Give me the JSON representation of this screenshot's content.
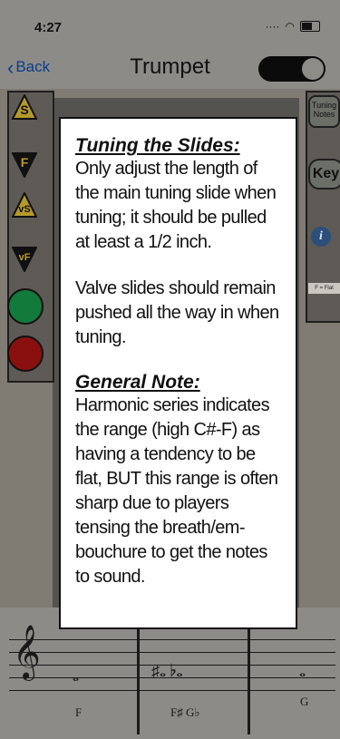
{
  "status": {
    "time": "4:27"
  },
  "nav": {
    "back_label": "Back",
    "title": "Trumpet"
  },
  "left_panel": {
    "up_label": "S",
    "down_label": "F",
    "vs_label": "vS",
    "vf_label": "vF"
  },
  "right_panel": {
    "tuning_notes": "Tuning Notes",
    "key": "Key",
    "flat_note": "F = Flat"
  },
  "dialog": {
    "heading1": "Tuning the Slides:",
    "para1": "Only adjust the length of the main tuning slide when tuning; it should be pulled at least a 1/2 inch.",
    "para2": "Valve slides should remain pushed all the way in when tuning.",
    "heading2": "General Note:",
    "para3": "Harmonic series indicates the range (high C#-F) as having a tendency to be flat, BUT this range is often sharp due to players tensing the breath/em-bouchure to get the notes to sound."
  },
  "staff": {
    "notes": [
      {
        "label": "F"
      },
      {
        "label": "F♯  G♭"
      },
      {
        "label": "G"
      }
    ]
  },
  "colors": {
    "accent": "#0a3d8c",
    "green": "#127a3a",
    "red": "#8a1010"
  }
}
